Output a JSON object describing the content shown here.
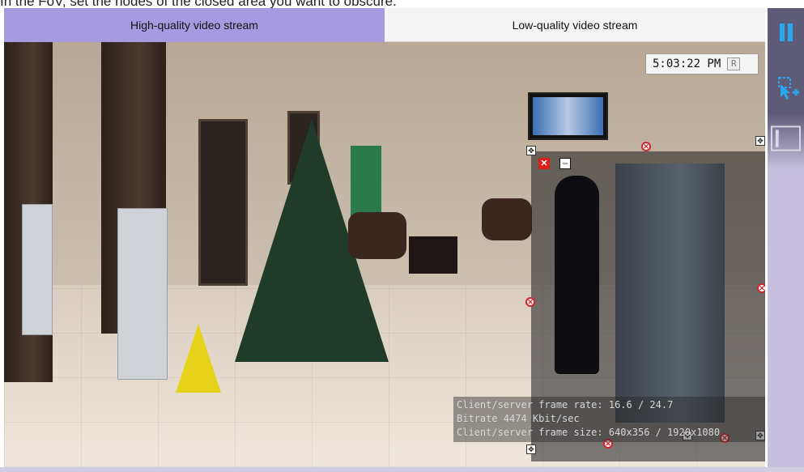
{
  "instruction": "In the FoV, set the nodes of the closed area you want to obscure.",
  "tabs": [
    {
      "label": "High-quality video stream",
      "active": true
    },
    {
      "label": "Low-quality video stream",
      "active": false
    }
  ],
  "clock": {
    "time": "5:03:22 PM",
    "button": "R"
  },
  "stats": {
    "line1": "Client/server frame rate: 16.6 / 24.7",
    "line2": "Bitrate 4474 Kbit/sec",
    "line3": "Client/server frame size: 640x356 / 1920x1080"
  },
  "controls": {
    "close_glyph": "✕",
    "move_glyph": "⇔",
    "node_glyph": "✕",
    "handle_glyph": "✥"
  },
  "toolbar": {
    "pause": "pause-icon",
    "add_mask": "select-add-icon",
    "mask_mode": "mask-mode-icon"
  },
  "colors": {
    "accent": "#a69be0",
    "sidebar": "#5e5b78",
    "node": "#d2262e"
  }
}
